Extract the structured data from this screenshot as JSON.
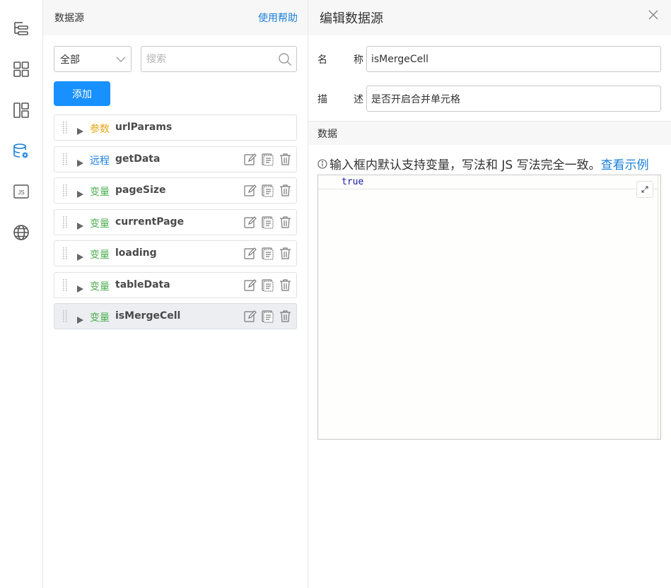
{
  "rail": {
    "items": [
      {
        "icon": "outline-tree-icon",
        "active": false
      },
      {
        "icon": "components-grid-icon",
        "active": false
      },
      {
        "icon": "page-layout-icon",
        "active": false
      },
      {
        "icon": "database-settings-icon",
        "active": true
      },
      {
        "icon": "js-code-icon",
        "active": false,
        "label": "JS"
      },
      {
        "icon": "globe-icon",
        "active": false
      }
    ]
  },
  "datasource_panel": {
    "title": "数据源",
    "help_link": "使用帮助",
    "filter": {
      "selected": "全部"
    },
    "search": {
      "placeholder": "搜索",
      "value": ""
    },
    "add_button": "添加",
    "items": [
      {
        "type": "参数",
        "type_color": "#e6a817",
        "name": "urlParams",
        "has_actions": false,
        "active": false
      },
      {
        "type": "远程",
        "type_color": "#1a7fd9",
        "name": "getData",
        "has_actions": true,
        "active": false
      },
      {
        "type": "变量",
        "type_color": "#4caf50",
        "name": "pageSize",
        "has_actions": true,
        "active": false
      },
      {
        "type": "变量",
        "type_color": "#4caf50",
        "name": "currentPage",
        "has_actions": true,
        "active": false
      },
      {
        "type": "变量",
        "type_color": "#4caf50",
        "name": "loading",
        "has_actions": true,
        "active": false
      },
      {
        "type": "变量",
        "type_color": "#4caf50",
        "name": "tableData",
        "has_actions": true,
        "active": false
      },
      {
        "type": "变量",
        "type_color": "#4caf50",
        "name": "isMergeCell",
        "has_actions": true,
        "active": true
      }
    ]
  },
  "editor": {
    "title": "编辑数据源",
    "name_label_1": "名",
    "name_label_2": "称",
    "name_value": "isMergeCell",
    "desc_label_1": "描",
    "desc_label_2": "述",
    "desc_value": "是否开启合并单元格",
    "section_title": "数据",
    "hint_text": "输入框内默认支持变量，写法和 JS 写法完全一致。",
    "hint_link": "查看示例",
    "code_value": "true"
  }
}
